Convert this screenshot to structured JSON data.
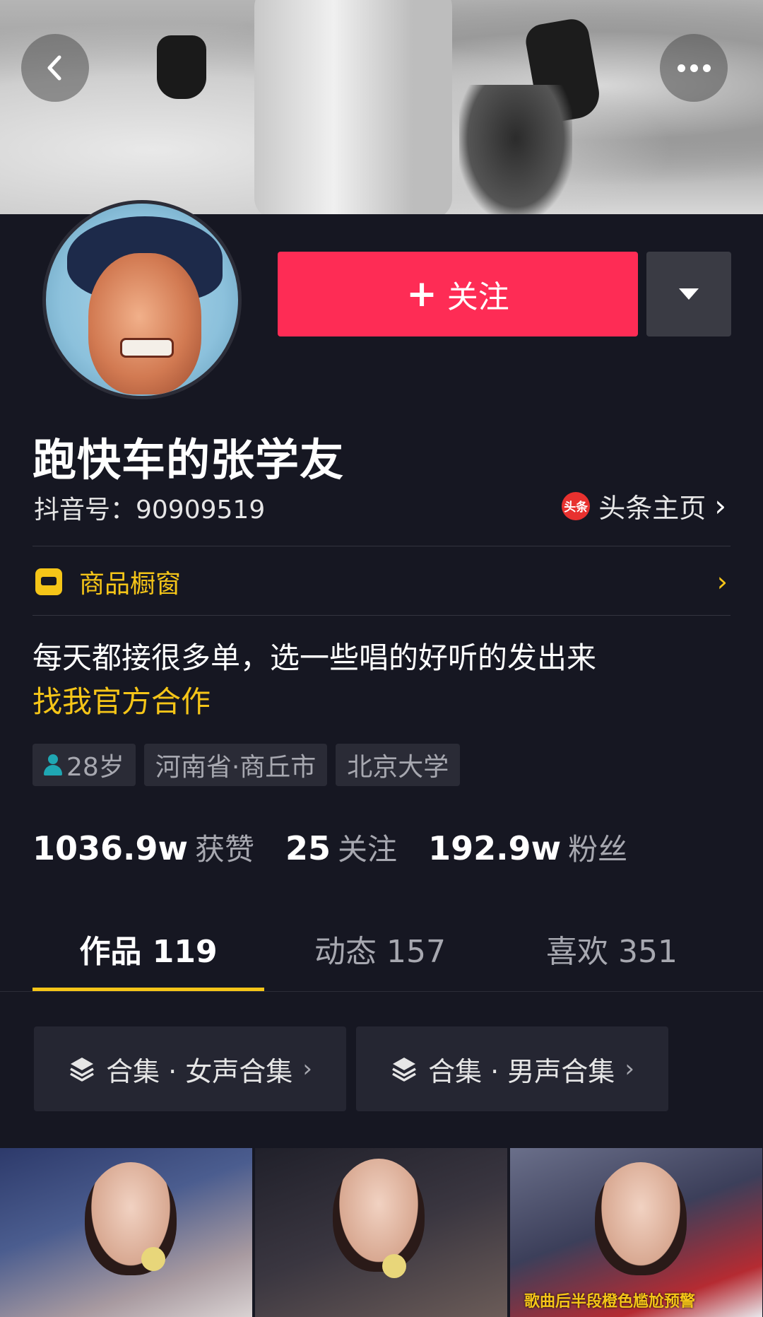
{
  "header": {
    "back_icon": "chevron-left-icon",
    "more_icon": "more-dots-icon"
  },
  "profile": {
    "name": "跑快车的张学友",
    "douyin_id": "抖音号：90909519",
    "toutiao_logo_text": "头条",
    "toutiao_label": "头条主页",
    "follow_button": "关注",
    "follow_color": "#fe2c55",
    "accent_color": "#f5c518"
  },
  "shop": {
    "label": "商品橱窗"
  },
  "bio": {
    "line1": "每天都接很多单，选一些唱的好听的发出来",
    "line2": "找我官方合作"
  },
  "tags": {
    "age": "28岁",
    "location": "河南省·商丘市",
    "school": "北京大学"
  },
  "stats": {
    "likes_num": "1036.9w",
    "likes_label": "获赞",
    "following_num": "25",
    "following_label": "关注",
    "fans_num": "192.9w",
    "fans_label": "粉丝"
  },
  "tabs": [
    {
      "label": "作品 119",
      "active": true
    },
    {
      "label": "动态 157",
      "active": false
    },
    {
      "label": "喜欢 351",
      "active": false
    }
  ],
  "collections": [
    {
      "label": "合集 · 女声合集"
    },
    {
      "label": "合集 · 男声合集"
    }
  ],
  "videos": [
    {
      "caption": ""
    },
    {
      "caption": ""
    },
    {
      "caption": "歌曲后半段橙色尴尬预警"
    }
  ]
}
